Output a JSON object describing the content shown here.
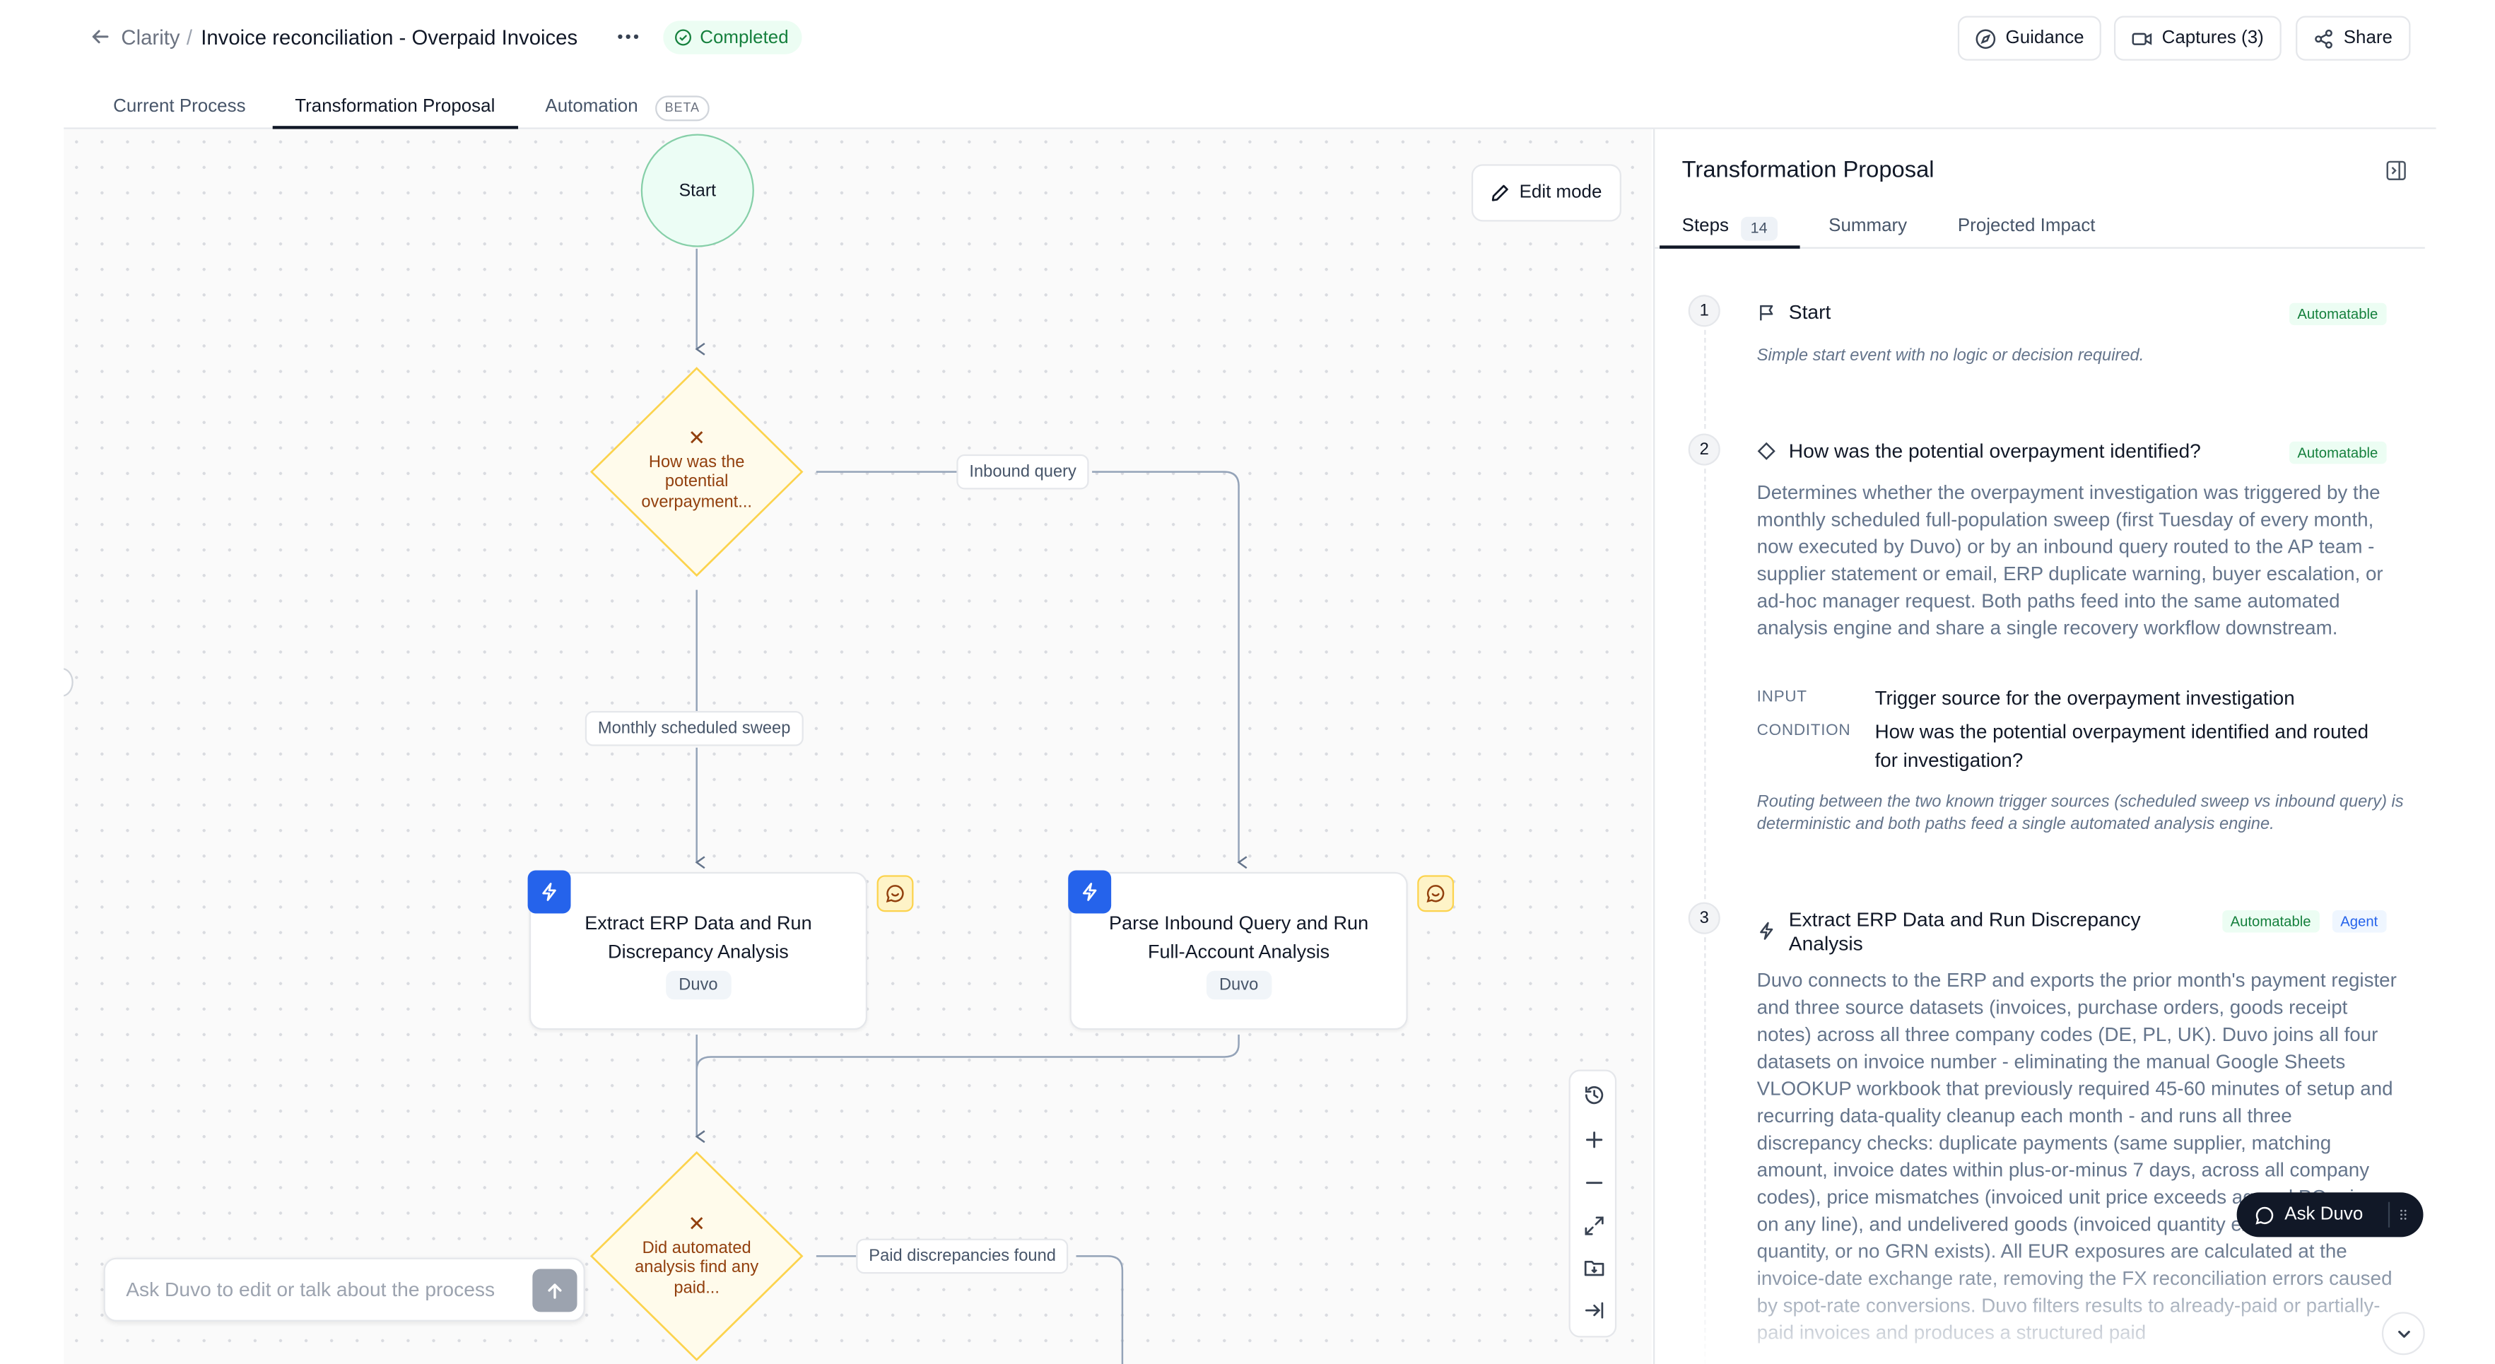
{
  "header": {
    "breadcrumb_root": "Clarity",
    "breadcrumb_sep": "/",
    "title": "Invoice reconciliation - Overpaid Invoices",
    "status": "Completed",
    "buttons": {
      "guidance": "Guidance",
      "captures": "Captures (3)",
      "share": "Share"
    }
  },
  "tabs": {
    "current_process": "Current Process",
    "transformation_proposal": "Transformation Proposal",
    "automation": "Automation",
    "automation_badge": "BETA"
  },
  "canvas": {
    "edit_mode": "Edit mode",
    "nodes": {
      "start": "Start",
      "decision1": "How was the potential overpayment...",
      "task1_title": "Extract ERP Data and Run Discrepancy Analysis",
      "task1_owner": "Duvo",
      "task2_title": "Parse Inbound Query and Run Full-Account Analysis",
      "task2_owner": "Duvo",
      "decision2": "Did automated analysis find any paid..."
    },
    "edge_labels": {
      "inbound_query": "Inbound query",
      "monthly_sweep": "Monthly scheduled sweep",
      "paid_found": "Paid discrepancies found"
    },
    "ask_placeholder": "Ask Duvo to edit or talk about the process"
  },
  "panel": {
    "title": "Transformation Proposal",
    "tabs": {
      "steps": "Steps",
      "steps_count": "14",
      "summary": "Summary",
      "impact": "Projected Impact"
    },
    "steps": [
      {
        "num": "1",
        "title": "Start",
        "badge": "Automatable",
        "note": "Simple start event with no logic or decision required."
      },
      {
        "num": "2",
        "title": "How was the potential overpayment identified?",
        "badge": "Automatable",
        "description": "Determines whether the overpayment investigation was triggered by the monthly scheduled full-population sweep (first Tuesday of every month, now executed by Duvo) or by an inbound query routed to the AP team - supplier statement or email, ERP duplicate warning, buyer escalation, or ad-hoc manager request. Both paths feed into the same automated analysis engine and share a single recovery workflow downstream.",
        "input_key": "INPUT",
        "input_val": "Trigger source for the overpayment investigation",
        "condition_key": "CONDITION",
        "condition_val": "How was the potential overpayment identified and routed for investigation?",
        "note": "Routing between the two known trigger sources (scheduled sweep vs inbound query) is deterministic and both paths feed a single automated analysis engine."
      },
      {
        "num": "3",
        "title": "Extract ERP Data and Run Discrepancy Analysis",
        "badge": "Automatable",
        "badge2": "Agent",
        "description": "Duvo connects to the ERP and exports the prior month's payment register and three source datasets (invoices, purchase orders, goods receipt notes) across all three company codes (DE, PL, UK). Duvo joins all four datasets on invoice number - eliminating the manual Google Sheets VLOOKUP workbook that previously required 45-60 minutes of setup and recurring data-quality cleanup each month - and runs all three discrepancy checks: duplicate payments (same supplier, matching amount, invoice dates within plus-or-minus 7 days, across all company codes), price mismatches (invoiced unit price exceeds agreed PO price on any line), and undelivered goods (invoiced quantity exceeds GRN quantity, or no GRN exists). All EUR exposures are calculated at the invoice-date exchange rate, removing the FX reconciliation errors caused by spot-rate conversions. Duvo filters results to already-paid or partially-paid invoices and produces a structured paid"
      }
    ]
  },
  "ask_duvo": "Ask Duvo"
}
